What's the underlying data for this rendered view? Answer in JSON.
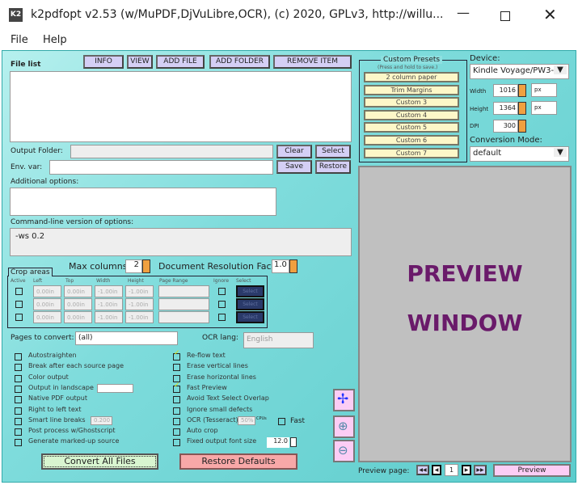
{
  "window": {
    "title": "k2pdfopt v2.53 (w/MuPDF,DjVuLibre,OCR), (c) 2020, GPLv3, http://willu...",
    "icon": "K2"
  },
  "menu": [
    "File",
    "Help"
  ],
  "file_list": {
    "label": "File list",
    "buttons": [
      "INFO",
      "VIEW",
      "ADD FILE",
      "ADD FOLDER",
      "REMOVE ITEM"
    ]
  },
  "output_folder": {
    "label": "Output Folder:",
    "value": "",
    "clear": "Clear",
    "select": "Select"
  },
  "env_var": {
    "label": "Env. var:",
    "value": "",
    "save": "Save",
    "restore": "Restore"
  },
  "additional_options": {
    "label": "Additional options:",
    "value": ""
  },
  "command_line": {
    "label": "Command-line version of options:",
    "value": "-ws 0.2"
  },
  "max_columns": {
    "label": "Max columns:",
    "value": "2"
  },
  "resolution": {
    "label": "Document Resolution Factor:",
    "value": "1.0"
  },
  "crop": {
    "title": "Crop areas",
    "headers": [
      "Active",
      "Left",
      "Top",
      "Width",
      "Height",
      "Page Range",
      "Ignore",
      "Select"
    ],
    "rows": [
      {
        "left": "0.00in",
        "top": "0.00in",
        "width": "-1.00in",
        "height": "-1.00in",
        "range": "",
        "select": "Select"
      },
      {
        "left": "0.00in",
        "top": "0.00in",
        "width": "-1.00in",
        "height": "-1.00in",
        "range": "",
        "select": "Select"
      },
      {
        "left": "0.00in",
        "top": "0.00in",
        "width": "-1.00in",
        "height": "-1.00in",
        "range": "",
        "select": "Select"
      }
    ]
  },
  "pages": {
    "label": "Pages to convert:",
    "value": "(all)"
  },
  "ocr_lang": {
    "label": "OCR lang:",
    "value": "English"
  },
  "options_left": [
    {
      "label": "Autostraighten",
      "checked": false
    },
    {
      "label": "Break after each source page",
      "checked": false
    },
    {
      "label": "Color output",
      "checked": false
    },
    {
      "label": "Output in landscape",
      "checked": false
    },
    {
      "label": "Native PDF output",
      "checked": false
    },
    {
      "label": "Right to left text",
      "checked": false
    },
    {
      "label": "Smart line breaks",
      "checked": false
    },
    {
      "label": "Post process w/Ghostscript",
      "checked": false
    },
    {
      "label": "Generate marked-up source",
      "checked": false
    }
  ],
  "landscape_value": "",
  "smart_value": "0.200",
  "options_right": [
    {
      "label": "Re-flow text",
      "checked": true
    },
    {
      "label": "Erase vertical lines",
      "checked": false
    },
    {
      "label": "Erase horizontal lines",
      "checked": false
    },
    {
      "label": "Fast Preview",
      "checked": true
    },
    {
      "label": "Avoid Text Select Overlap",
      "checked": false
    },
    {
      "label": "Ignore small defects",
      "checked": false
    },
    {
      "label": "OCR (Tesseract)",
      "checked": false
    },
    {
      "label": "Auto crop",
      "checked": false
    },
    {
      "label": "Fixed output font size",
      "checked": false
    }
  ],
  "ocr_cpu": "50%",
  "ocr_cpu_unit": "CPUs",
  "fast_label": "Fast",
  "font_size": "12.0",
  "convert": "Convert All Files",
  "restore_defaults": "Restore Defaults",
  "presets": {
    "title": "Custom Presets",
    "subtitle": "(Press and hold to save.)",
    "items": [
      "2 column paper",
      "Trim Margins",
      "Custom 3",
      "Custom 4",
      "Custom 5",
      "Custom 6",
      "Custom 7"
    ]
  },
  "device": {
    "label": "Device:",
    "value": "Kindle Voyage/PW3-",
    "width_label": "Width",
    "width": "1016",
    "height_label": "Height",
    "height": "1364",
    "unit": "px",
    "dpi_label": "DPI",
    "dpi": "300"
  },
  "mode": {
    "label": "Conversion Mode:",
    "value": "default"
  },
  "preview": {
    "line1": "PREVIEW",
    "line2": "WINDOW",
    "page_label": "Preview page:",
    "page": "1",
    "button": "Preview",
    "text_color": "#6a1a6a"
  }
}
